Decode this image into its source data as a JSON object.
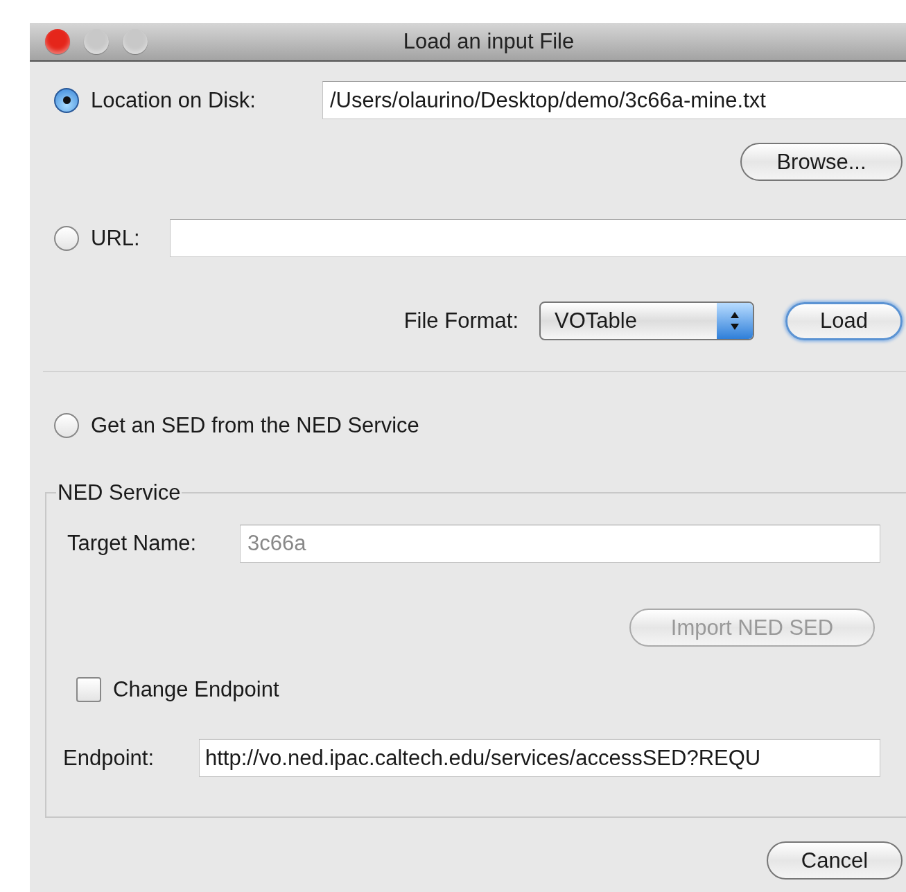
{
  "window": {
    "title": "Load an input File"
  },
  "source_options": [
    {
      "kind": "disk",
      "label": "Location on Disk:",
      "selected": true,
      "value": "/Users/olaurino/Desktop/demo/3c66a-mine.txt"
    },
    {
      "kind": "url",
      "label": "URL:",
      "selected": false
    },
    {
      "kind": "ned",
      "label": "Get an SED from the NED Service",
      "selected": false
    }
  ],
  "browse_button": "Browse...",
  "file_format": {
    "label": "File Format:",
    "value": "VOTable"
  },
  "load_button": "Load",
  "ned_service": {
    "title": "NED Service",
    "target_label": "Target Name:",
    "target_value": "3c66a",
    "target_disabled": true,
    "import_button": {
      "label": "Import NED SED",
      "disabled": true
    },
    "change_endpoint": {
      "label": "Change Endpoint",
      "checked": false
    },
    "endpoint_label": "Endpoint:",
    "endpoint_value": "http://vo.ned.ipac.caltech.edu/services/accessSED?REQU"
  },
  "cancel_button": "Cancel"
}
